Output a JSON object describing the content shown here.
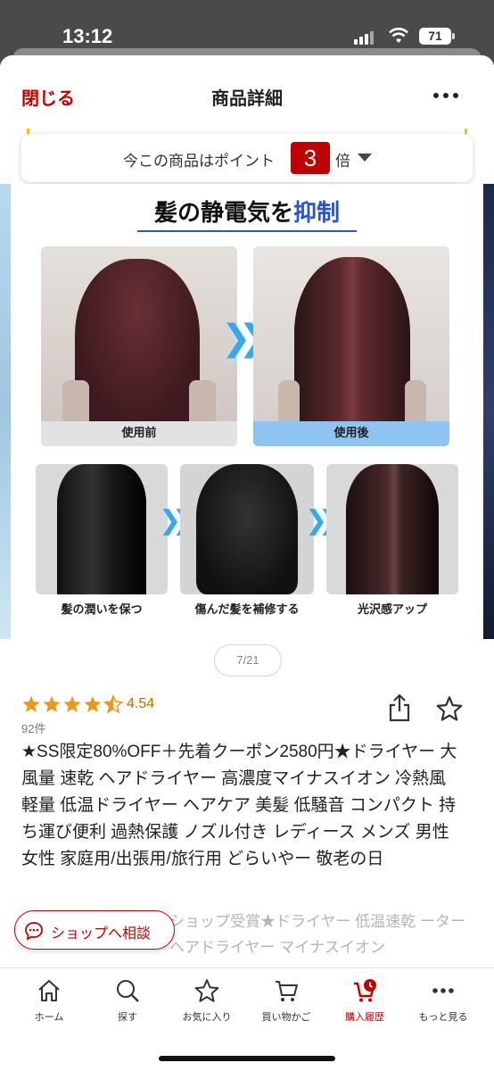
{
  "status_bar": {
    "time": "13:12",
    "battery": "71"
  },
  "nav": {
    "close_label": "閉じる",
    "title": "商品詳細"
  },
  "points": {
    "text": "今この商品はポイント",
    "multiplier": "3",
    "suffix": "倍"
  },
  "image": {
    "headline_plain": "髪の静電気を",
    "headline_emphasis": "抑制",
    "before_label": "使用前",
    "after_label": "使用後",
    "step1_label": "髪の潤いを保つ",
    "step2_label": "傷んだ髪を補修する",
    "step3_label": "光沢感アップ"
  },
  "carousel": {
    "page_indicator": "7/21"
  },
  "rating": {
    "value": "4.54",
    "stars": 4.5,
    "review_count": "92件"
  },
  "product": {
    "title": "★SS限定80%OFF＋先着クーポン2580円★ドライヤー 大風量 速乾 ヘアドライヤー 高濃度マイナスイオン 冷熱風 軽量 低温ドライヤー ヘアケア 美髪 低騒音 コンパクト 持ち運び便利 過熱保護 ノズル付き レディース メンズ 男性 女性 家庭用/出張用/旅行用 どらいやー 敬老の日",
    "subtitle": "ショップ受賞★ドライヤー 低温速乾 ーター ヘアドライヤー マイナスイオン"
  },
  "shop_consult_label": "ショップへ相談",
  "tabs": [
    {
      "label": "ホーム",
      "icon": "home-icon"
    },
    {
      "label": "探す",
      "icon": "search-icon"
    },
    {
      "label": "お気に入り",
      "icon": "star-icon"
    },
    {
      "label": "買い物かご",
      "icon": "cart-icon"
    },
    {
      "label": "購入履歴",
      "icon": "purchase-history-icon"
    },
    {
      "label": "もっと見る",
      "icon": "more-icon"
    }
  ],
  "colors": {
    "brand": "#bf0000",
    "rating": "#bf6a00",
    "accent_blue": "#2a55c8"
  }
}
